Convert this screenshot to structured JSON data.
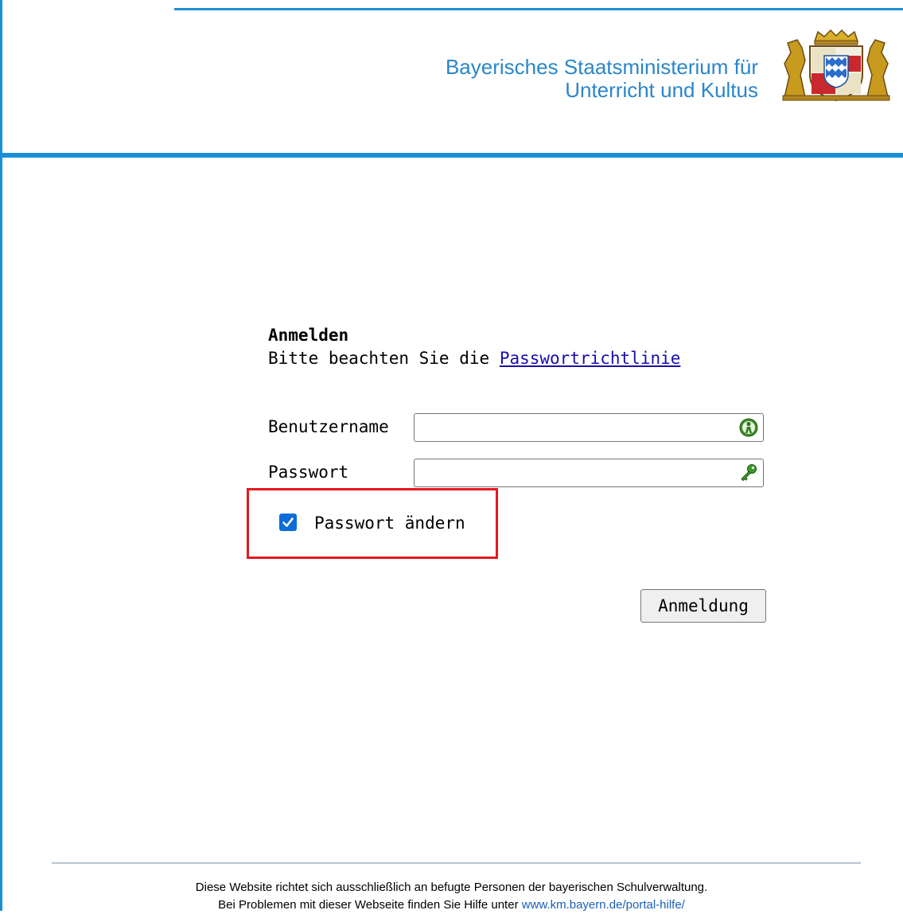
{
  "header": {
    "ministry_line1": "Bayerisches Staatsministerium für",
    "ministry_line2": "Unterricht und Kultus",
    "crest_icon": "bavarian-coat-of-arms-icon",
    "accent_color": "#1b8fd6"
  },
  "login": {
    "title": "Anmelden",
    "hint_prefix": "Bitte beachten Sie die",
    "hint_link": "Passwortrichtlinie",
    "username_label": "Benutzername",
    "username_value": "",
    "username_icon": "user-icon",
    "password_label": "Passwort",
    "password_value": "",
    "password_icon": "key-icon",
    "change_password_label": "Passwort ändern",
    "change_password_checked": true,
    "submit_label": "Anmeldung"
  },
  "footer": {
    "line1": "Diese Website richtet sich ausschließlich an befugte Personen der bayerischen Schulverwaltung.",
    "line2_prefix": "Bei Problemen mit dieser Webseite finden Sie Hilfe unter",
    "line2_link": "www.km.bayern.de/portal-hilfe/"
  }
}
